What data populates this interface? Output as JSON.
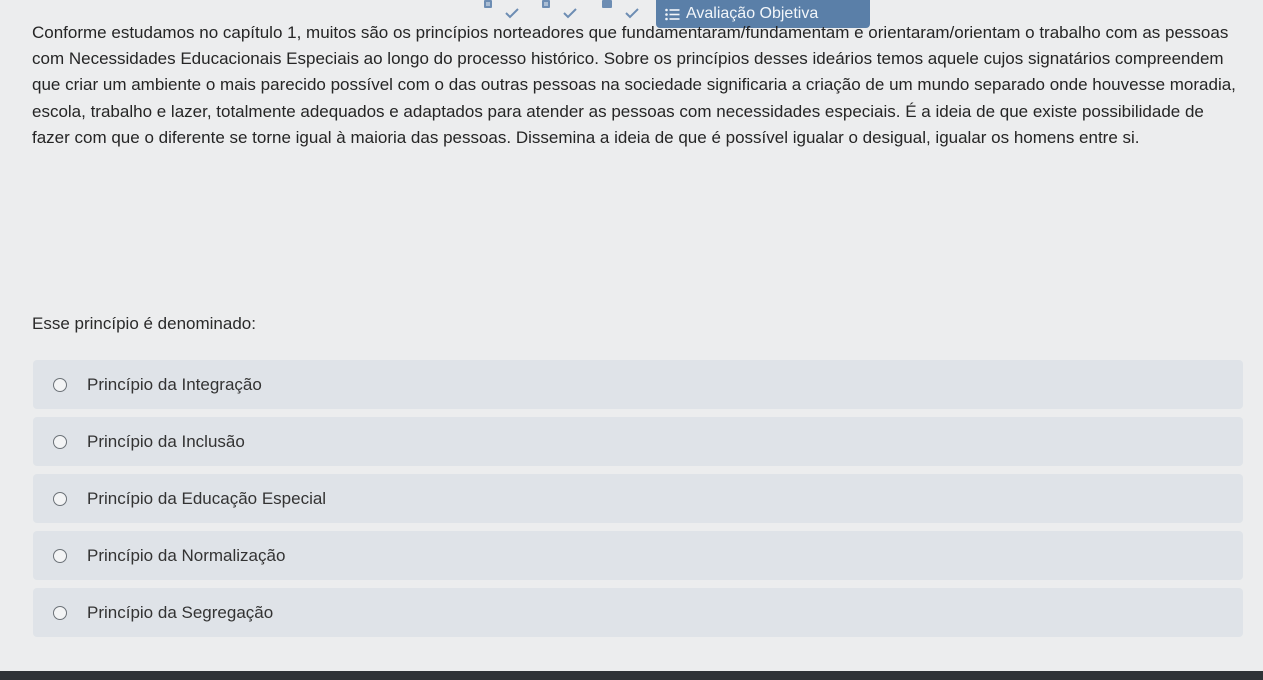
{
  "header": {
    "tab_label": "Avaliação Objetiva",
    "tab_icon": "list-icon",
    "nav_icons": [
      "document-check-icon",
      "document-check-icon",
      "document-check-icon"
    ],
    "accent_color": "#5a7fa8"
  },
  "question": {
    "text": "Conforme estudamos no capítulo 1, muitos são os princípios norteadores que fundamentaram/fundamentam e orientaram/orientam o trabalho com as pessoas com Necessidades Educacionais Especiais ao longo do processo histórico. Sobre os princípios desses ideários temos aquele cujos signatários compreendem que criar um ambiente o mais parecido possível com o das outras pessoas na sociedade significaria a criação de um mundo separado onde houvesse moradia, escola, trabalho e lazer, totalmente adequados e adaptados para atender as pessoas com necessidades especiais. É a ideia de que existe possibilidade de fazer com que o diferente se torne igual à maioria das pessoas. Dissemina a ideia de que é possível igualar o desigual, igualar os homens entre si.",
    "prompt": "Esse princípio é denominado:"
  },
  "options": [
    {
      "label": "Princípio da Integração"
    },
    {
      "label": "Princípio da Inclusão"
    },
    {
      "label": "Princípio da Educação Especial"
    },
    {
      "label": "Princípio da Normalização"
    },
    {
      "label": "Princípio da Segregação"
    }
  ]
}
